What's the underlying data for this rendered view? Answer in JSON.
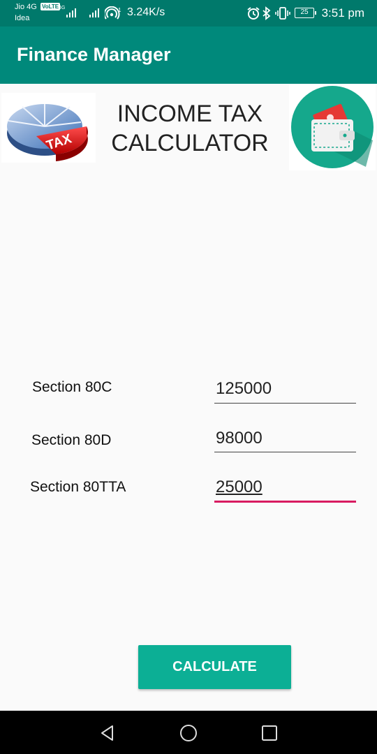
{
  "status_bar": {
    "carrier_1": "Jio 4G",
    "carrier_2": "Idea",
    "volte": "VoLTE",
    "network_type": "4G",
    "speed": "3.24K/s",
    "battery": "25",
    "time": "3:51 pm",
    "icons": [
      "signal-icon",
      "wifi-hotspot-icon",
      "alarm-icon",
      "bluetooth-icon",
      "vibrate-icon",
      "battery-icon"
    ]
  },
  "app_bar": {
    "title": "Finance Manager"
  },
  "header": {
    "title_line1": "INCOME TAX",
    "title_line2": "CALCULATOR",
    "logo_text": "TAX",
    "left_image": "tax-pie-icon",
    "right_image": "wallet-icon"
  },
  "form": {
    "rows": [
      {
        "label": "Section 80C",
        "value": "125000"
      },
      {
        "label": "Section 80D",
        "value": "98000"
      },
      {
        "label": "Section 80TTA",
        "value": "25000"
      }
    ],
    "calculate_label": "CALCULATE"
  },
  "colors": {
    "status_bar": "#00796b",
    "app_bar": "#00897b",
    "button": "#0caf95",
    "focus_underline": "#d81b60",
    "wallet_circle": "#15a88c"
  },
  "nav_bar": {
    "buttons": [
      "back-icon",
      "home-icon",
      "recents-icon"
    ]
  }
}
